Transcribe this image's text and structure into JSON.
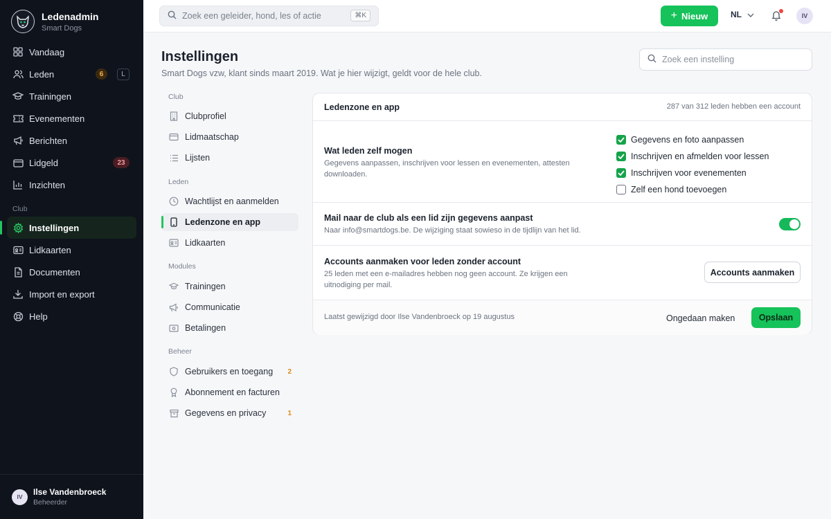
{
  "app": {
    "name": "Ledenadmin",
    "org": "Smart Dogs"
  },
  "sidebar": {
    "items": [
      {
        "label": "Vandaag",
        "icon": "dashboard-icon"
      },
      {
        "label": "Leden",
        "icon": "users-icon",
        "badge": "6",
        "shortcut": "L"
      },
      {
        "label": "Trainingen",
        "icon": "graduation-cap-icon"
      },
      {
        "label": "Evenementen",
        "icon": "ticket-icon"
      },
      {
        "label": "Berichten",
        "icon": "megaphone-icon"
      },
      {
        "label": "Lidgeld",
        "icon": "wallet-icon",
        "badge": "23"
      },
      {
        "label": "Inzichten",
        "icon": "bar-chart-icon"
      }
    ],
    "section_label": "Club",
    "club_items": [
      {
        "label": "Instellingen",
        "icon": "gear-icon",
        "active": true
      },
      {
        "label": "Lidkaarten",
        "icon": "id-card-icon"
      },
      {
        "label": "Documenten",
        "icon": "document-icon"
      },
      {
        "label": "Import en export",
        "icon": "download-icon"
      },
      {
        "label": "Help",
        "icon": "lifebuoy-icon"
      }
    ],
    "user": {
      "initials": "IV",
      "name": "Ilse Vandenbroeck",
      "role": "Beheerder"
    }
  },
  "topbar": {
    "search_placeholder": "Zoek een geleider, hond, les of actie",
    "search_shortcut": "⌘K",
    "new_button": "Nieuw",
    "language": "NL",
    "avatar_initials": "IV"
  },
  "page": {
    "title": "Instellingen",
    "subtitle": "Smart Dogs vzw, klant sinds maart 2019. Wat je hier wijzigt, geldt voor de hele club.",
    "settings_search_placeholder": "Zoek een instelling"
  },
  "subnav": {
    "sections": [
      {
        "label": "Club",
        "items": [
          {
            "label": "Clubprofiel",
            "icon": "building-icon"
          },
          {
            "label": "Lidmaatschap",
            "icon": "wallet-icon"
          },
          {
            "label": "Lijsten",
            "icon": "list-icon"
          }
        ]
      },
      {
        "label": "Leden",
        "items": [
          {
            "label": "Wachtlijst en aanmelden",
            "icon": "clock-icon"
          },
          {
            "label": "Ledenzone en app",
            "icon": "phone-icon",
            "active": true
          },
          {
            "label": "Lidkaarten",
            "icon": "id-card-icon"
          }
        ]
      },
      {
        "label": "Modules",
        "items": [
          {
            "label": "Trainingen",
            "icon": "graduation-cap-icon"
          },
          {
            "label": "Communicatie",
            "icon": "megaphone-icon"
          },
          {
            "label": "Betalingen",
            "icon": "banknote-icon"
          }
        ]
      },
      {
        "label": "Beheer",
        "items": [
          {
            "label": "Gebruikers en toegang",
            "icon": "shield-icon",
            "count": "2"
          },
          {
            "label": "Abonnement en facturen",
            "icon": "award-icon"
          },
          {
            "label": "Gegevens en privacy",
            "icon": "archive-icon",
            "count": "1"
          }
        ]
      }
    ]
  },
  "card": {
    "title": "Ledenzone en app",
    "meta": "287 van 312 leden hebben een account",
    "permissions": {
      "title": "Wat leden zelf mogen",
      "description": "Gegevens aanpassen, inschrijven voor lessen en evenementen, attesten downloaden.",
      "options": [
        {
          "label": "Gegevens en foto aanpassen",
          "checked": true
        },
        {
          "label": "Inschrijven en afmelden voor lessen",
          "checked": true
        },
        {
          "label": "Inschrijven voor evenementen",
          "checked": true
        },
        {
          "label": "Zelf een hond toevoegen",
          "checked": false
        }
      ]
    },
    "mail": {
      "title": "Mail naar de club als een lid zijn gegevens aanpast",
      "description": "Naar info@smartdogs.be. De wijziging staat sowieso in de tijdlijn van het lid.",
      "enabled": true
    },
    "accounts": {
      "title": "Accounts aanmaken voor leden zonder account",
      "description": "25 leden met een e-mailadres hebben nog geen account. Ze krijgen een uitnodiging per mail.",
      "button": "Accounts aanmaken"
    },
    "footer": {
      "note": "Laatst gewijzigd door Ilse Vandenbroeck op 19 augustus",
      "undo": "Ongedaan maken",
      "save": "Opslaan"
    }
  },
  "colors": {
    "accent": "#16c25a",
    "sidebar_bg": "#0f131c",
    "badge_amber": "#f5b04a",
    "badge_red": "#f19aa2"
  }
}
